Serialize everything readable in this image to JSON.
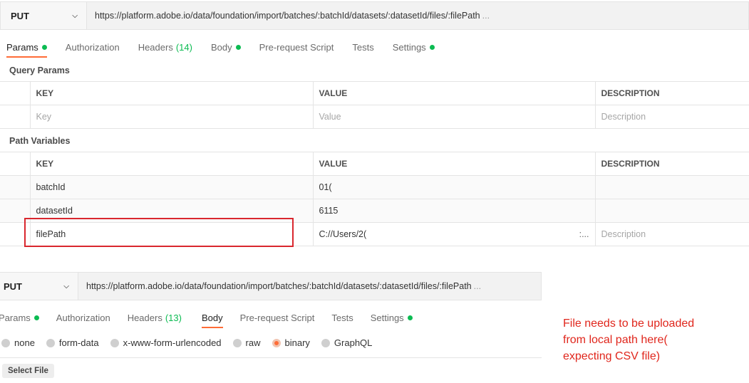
{
  "top": {
    "method": "PUT",
    "url": "https://platform.adobe.io/data/foundation/import/batches/:batchId/datasets/:datasetId/files/:filePath",
    "url_ellipsis": "...",
    "tabs": [
      {
        "label": "Params"
      },
      {
        "label": "Authorization"
      },
      {
        "label": "Headers",
        "count": "(14)"
      },
      {
        "label": "Body"
      },
      {
        "label": "Pre-request Script"
      },
      {
        "label": "Tests"
      },
      {
        "label": "Settings"
      }
    ],
    "query_params": {
      "title": "Query Params",
      "headers": [
        "KEY",
        "VALUE",
        "DESCRIPTION"
      ],
      "placeholders": [
        "Key",
        "Value",
        "Description"
      ]
    },
    "path_variables": {
      "title": "Path Variables",
      "headers": [
        "KEY",
        "VALUE",
        "DESCRIPTION"
      ],
      "rows": [
        {
          "key": "batchId",
          "value": "01(",
          "description": ""
        },
        {
          "key": "datasetId",
          "value": "6115",
          "description": ""
        },
        {
          "key": "filePath",
          "value": "C://Users/2(",
          "value_more": ":...",
          "description_placeholder": "Description"
        }
      ]
    }
  },
  "bottom": {
    "method": "PUT",
    "url": "https://platform.adobe.io/data/foundation/import/batches/:batchId/datasets/:datasetId/files/:filePath",
    "url_ellipsis": "...",
    "tabs": [
      {
        "label": "Params"
      },
      {
        "label": "Authorization"
      },
      {
        "label": "Headers",
        "count": "(13)"
      },
      {
        "label": "Body"
      },
      {
        "label": "Pre-request Script"
      },
      {
        "label": "Tests"
      },
      {
        "label": "Settings"
      }
    ],
    "body_types": [
      "none",
      "form-data",
      "x-www-form-urlencoded",
      "raw",
      "binary",
      "GraphQL"
    ],
    "selected_body_type": "binary",
    "select_file_label": "Select File"
  },
  "annotation": {
    "lines": [
      "File needs to be uploaded",
      "from local path here(",
      "expecting CSV file)"
    ]
  },
  "colors": {
    "accent": "#ff6c37",
    "status_dot": "#0cbb52",
    "annotation": "#e0261c"
  }
}
